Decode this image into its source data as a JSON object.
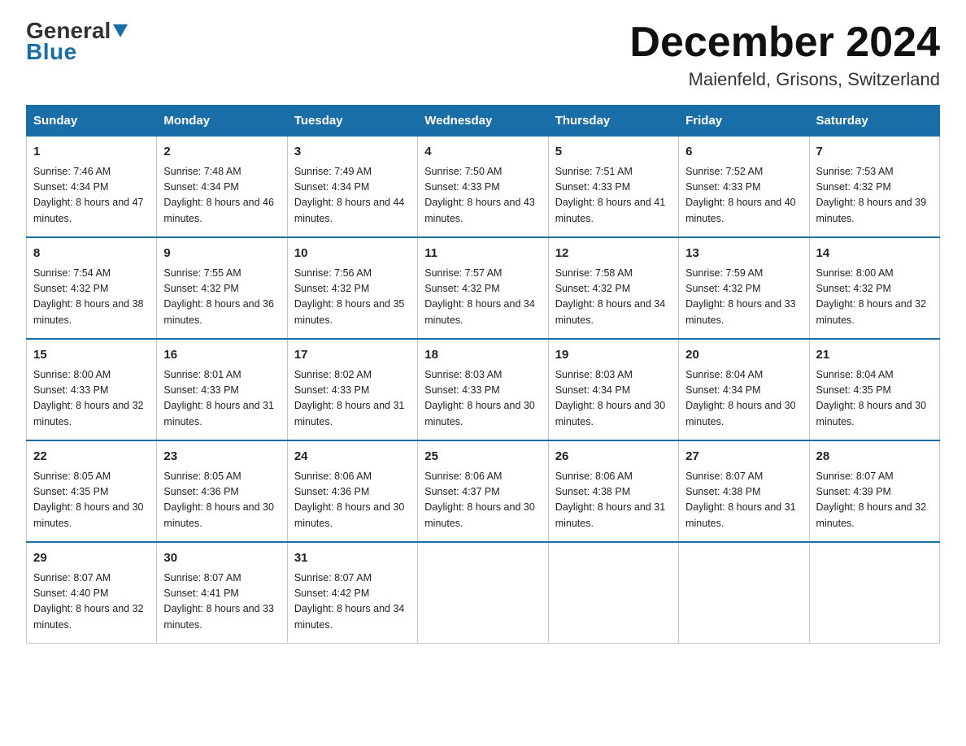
{
  "header": {
    "logo_general": "General",
    "logo_blue": "Blue",
    "month_title": "December 2024",
    "location": "Maienfeld, Grisons, Switzerland"
  },
  "days_of_week": [
    "Sunday",
    "Monday",
    "Tuesday",
    "Wednesday",
    "Thursday",
    "Friday",
    "Saturday"
  ],
  "weeks": [
    [
      {
        "day": "1",
        "sunrise": "7:46 AM",
        "sunset": "4:34 PM",
        "daylight": "8 hours and 47 minutes."
      },
      {
        "day": "2",
        "sunrise": "7:48 AM",
        "sunset": "4:34 PM",
        "daylight": "8 hours and 46 minutes."
      },
      {
        "day": "3",
        "sunrise": "7:49 AM",
        "sunset": "4:34 PM",
        "daylight": "8 hours and 44 minutes."
      },
      {
        "day": "4",
        "sunrise": "7:50 AM",
        "sunset": "4:33 PM",
        "daylight": "8 hours and 43 minutes."
      },
      {
        "day": "5",
        "sunrise": "7:51 AM",
        "sunset": "4:33 PM",
        "daylight": "8 hours and 41 minutes."
      },
      {
        "day": "6",
        "sunrise": "7:52 AM",
        "sunset": "4:33 PM",
        "daylight": "8 hours and 40 minutes."
      },
      {
        "day": "7",
        "sunrise": "7:53 AM",
        "sunset": "4:32 PM",
        "daylight": "8 hours and 39 minutes."
      }
    ],
    [
      {
        "day": "8",
        "sunrise": "7:54 AM",
        "sunset": "4:32 PM",
        "daylight": "8 hours and 38 minutes."
      },
      {
        "day": "9",
        "sunrise": "7:55 AM",
        "sunset": "4:32 PM",
        "daylight": "8 hours and 36 minutes."
      },
      {
        "day": "10",
        "sunrise": "7:56 AM",
        "sunset": "4:32 PM",
        "daylight": "8 hours and 35 minutes."
      },
      {
        "day": "11",
        "sunrise": "7:57 AM",
        "sunset": "4:32 PM",
        "daylight": "8 hours and 34 minutes."
      },
      {
        "day": "12",
        "sunrise": "7:58 AM",
        "sunset": "4:32 PM",
        "daylight": "8 hours and 34 minutes."
      },
      {
        "day": "13",
        "sunrise": "7:59 AM",
        "sunset": "4:32 PM",
        "daylight": "8 hours and 33 minutes."
      },
      {
        "day": "14",
        "sunrise": "8:00 AM",
        "sunset": "4:32 PM",
        "daylight": "8 hours and 32 minutes."
      }
    ],
    [
      {
        "day": "15",
        "sunrise": "8:00 AM",
        "sunset": "4:33 PM",
        "daylight": "8 hours and 32 minutes."
      },
      {
        "day": "16",
        "sunrise": "8:01 AM",
        "sunset": "4:33 PM",
        "daylight": "8 hours and 31 minutes."
      },
      {
        "day": "17",
        "sunrise": "8:02 AM",
        "sunset": "4:33 PM",
        "daylight": "8 hours and 31 minutes."
      },
      {
        "day": "18",
        "sunrise": "8:03 AM",
        "sunset": "4:33 PM",
        "daylight": "8 hours and 30 minutes."
      },
      {
        "day": "19",
        "sunrise": "8:03 AM",
        "sunset": "4:34 PM",
        "daylight": "8 hours and 30 minutes."
      },
      {
        "day": "20",
        "sunrise": "8:04 AM",
        "sunset": "4:34 PM",
        "daylight": "8 hours and 30 minutes."
      },
      {
        "day": "21",
        "sunrise": "8:04 AM",
        "sunset": "4:35 PM",
        "daylight": "8 hours and 30 minutes."
      }
    ],
    [
      {
        "day": "22",
        "sunrise": "8:05 AM",
        "sunset": "4:35 PM",
        "daylight": "8 hours and 30 minutes."
      },
      {
        "day": "23",
        "sunrise": "8:05 AM",
        "sunset": "4:36 PM",
        "daylight": "8 hours and 30 minutes."
      },
      {
        "day": "24",
        "sunrise": "8:06 AM",
        "sunset": "4:36 PM",
        "daylight": "8 hours and 30 minutes."
      },
      {
        "day": "25",
        "sunrise": "8:06 AM",
        "sunset": "4:37 PM",
        "daylight": "8 hours and 30 minutes."
      },
      {
        "day": "26",
        "sunrise": "8:06 AM",
        "sunset": "4:38 PM",
        "daylight": "8 hours and 31 minutes."
      },
      {
        "day": "27",
        "sunrise": "8:07 AM",
        "sunset": "4:38 PM",
        "daylight": "8 hours and 31 minutes."
      },
      {
        "day": "28",
        "sunrise": "8:07 AM",
        "sunset": "4:39 PM",
        "daylight": "8 hours and 32 minutes."
      }
    ],
    [
      {
        "day": "29",
        "sunrise": "8:07 AM",
        "sunset": "4:40 PM",
        "daylight": "8 hours and 32 minutes."
      },
      {
        "day": "30",
        "sunrise": "8:07 AM",
        "sunset": "4:41 PM",
        "daylight": "8 hours and 33 minutes."
      },
      {
        "day": "31",
        "sunrise": "8:07 AM",
        "sunset": "4:42 PM",
        "daylight": "8 hours and 34 minutes."
      },
      null,
      null,
      null,
      null
    ]
  ],
  "labels": {
    "sunrise": "Sunrise:",
    "sunset": "Sunset:",
    "daylight": "Daylight:"
  }
}
